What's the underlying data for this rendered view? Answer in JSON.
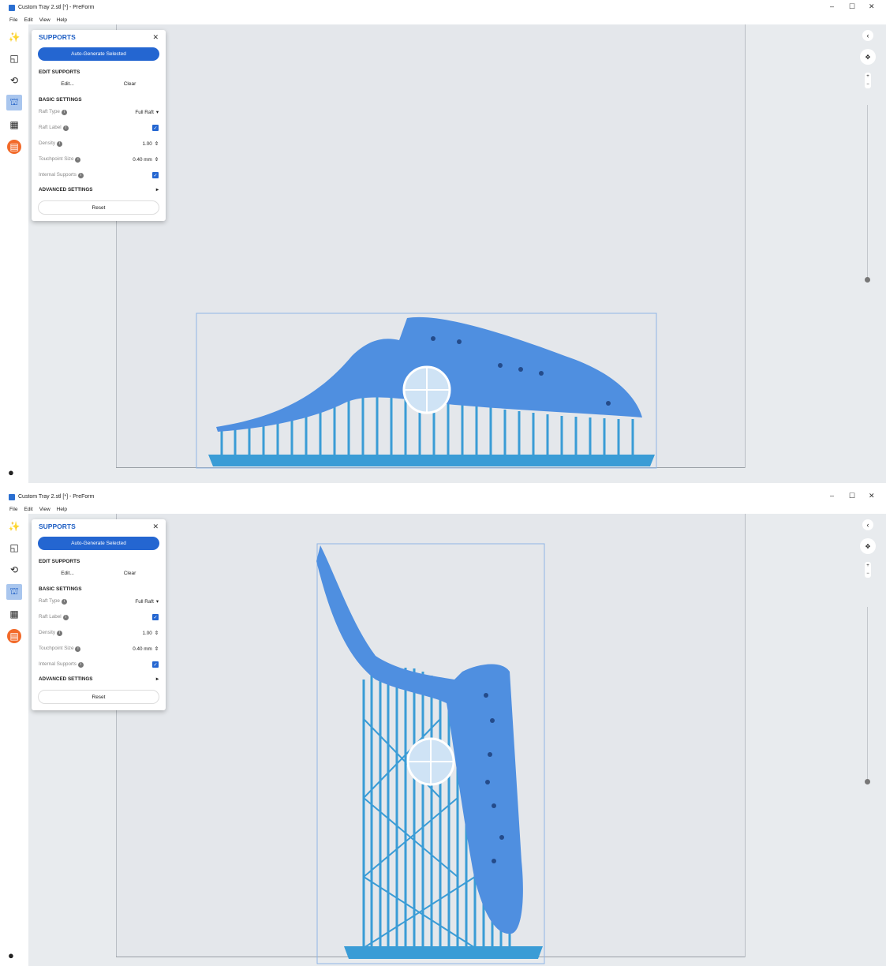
{
  "window": {
    "title": "Custom Tray 2.stl [*] - PreForm",
    "minimize": "–",
    "maximize": "☐",
    "close": "✕"
  },
  "menu": [
    "File",
    "Edit",
    "View",
    "Help"
  ],
  "toolbar": {
    "tools": [
      {
        "name": "magic-wand-icon",
        "glyph": "✨"
      },
      {
        "name": "layout-icon",
        "glyph": "◱"
      },
      {
        "name": "orientation-icon",
        "glyph": "⟲"
      },
      {
        "name": "supports-icon",
        "glyph": "⛫"
      },
      {
        "name": "layout-grid-icon",
        "glyph": "▦"
      },
      {
        "name": "print-icon",
        "glyph": "▤"
      }
    ],
    "account_glyph": "●"
  },
  "panel": {
    "title": "SUPPORTS",
    "close": "✕",
    "auto_generate": "Auto-Generate Selected",
    "edit_section": "EDIT SUPPORTS",
    "edit_btn": "Edit...",
    "clear_btn": "Clear",
    "basic_section": "BASIC SETTINGS",
    "raft_type_label": "Raft Type",
    "raft_type_value": "Full Raft",
    "raft_label_label": "Raft Label",
    "raft_label_checked": true,
    "density_label": "Density",
    "density_value": "1.00",
    "touchpoint_label": "Touchpoint Size",
    "touchpoint_value": "0.40 mm",
    "internal_label": "Internal Supports",
    "internal_checked": true,
    "advanced_section": "ADVANCED SETTINGS",
    "reset": "Reset",
    "info_glyph": "i",
    "check_glyph": "✓",
    "dropdown_glyph": "▾",
    "spinner_glyph": "⇕",
    "expand_glyph": "▸"
  },
  "nav": {
    "back": "‹",
    "pad": "✥",
    "zoom_in": "+",
    "zoom_out": "−"
  },
  "colors": {
    "accent": "#2466d1",
    "model": "#4f8fe0",
    "supports": "#3a9cd6",
    "orange": "#f26a2a"
  }
}
